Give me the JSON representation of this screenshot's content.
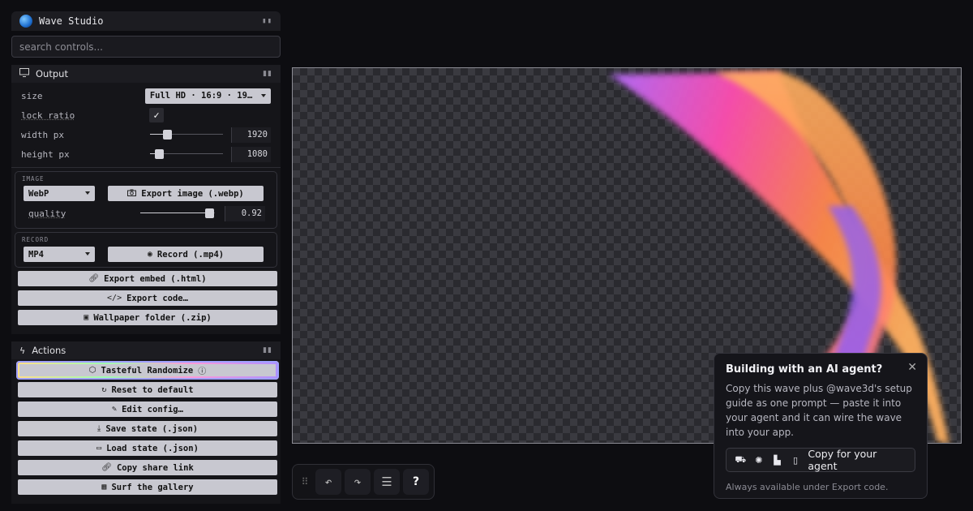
{
  "app": {
    "title": "Wave Studio"
  },
  "search": {
    "placeholder": "search controls..."
  },
  "output": {
    "title": "Output",
    "size_label": "size",
    "size_value": "Full HD · 16:9 · 19…",
    "lock_label": "lock ratio",
    "lock_checked": true,
    "width_label": "width px",
    "width_value": "1920",
    "height_label": "height px",
    "height_value": "1080",
    "image": {
      "title": "IMAGE",
      "format": "WebP",
      "export_label": "Export image (.webp)",
      "quality_label": "quality",
      "quality_value": "0.92"
    },
    "record": {
      "title": "RECORD",
      "format": "MP4",
      "record_label": "Record (.mp4)"
    },
    "export_embed": "Export embed (.html)",
    "export_code": "Export code…",
    "wallpaper": "Wallpaper folder (.zip)"
  },
  "actions": {
    "title": "Actions",
    "randomize": "Tasteful Randomize",
    "reset": "Reset to default",
    "edit_config": "Edit config…",
    "save_state": "Save state (.json)",
    "load_state": "Load state (.json)",
    "share_link": "Copy share link",
    "gallery": "Surf the gallery"
  },
  "toolbar": {
    "help_label": "?"
  },
  "agent_popup": {
    "title": "Building with an AI agent?",
    "body": "Copy this wave plus @wave3d's setup guide as one prompt — paste it into your agent and it can wire the wave into your app.",
    "button_label": "Copy for your agent",
    "footer": "Always available under Export code."
  },
  "icons": {
    "close": "close-icon",
    "undo": "undo-icon",
    "redo": "redo-icon",
    "list": "list-icon",
    "grip": "grip-icon"
  }
}
